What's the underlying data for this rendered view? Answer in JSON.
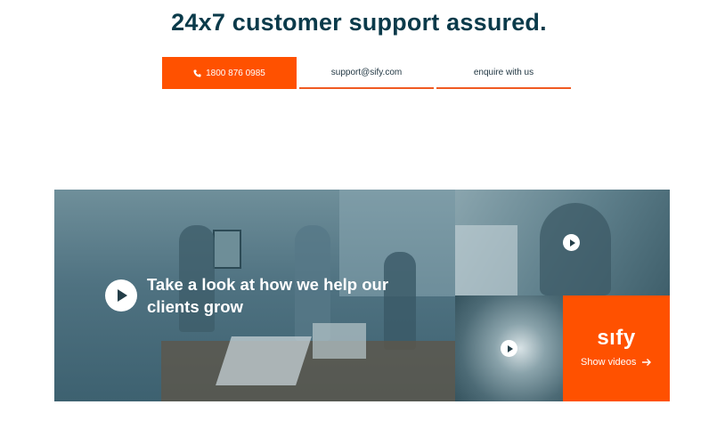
{
  "heading": "24x7 customer support assured.",
  "contacts": {
    "phone": {
      "label": "1800 876 0985",
      "icon": "phone-icon"
    },
    "email": {
      "label": "support@sify.com"
    },
    "enquire": {
      "label": "enquire with us"
    }
  },
  "media": {
    "main_headline": "Take a look at how we help our clients grow",
    "brand": {
      "logo": "sıfy",
      "link_label": "Show videos",
      "icon": "arrow-right-icon"
    }
  },
  "colors": {
    "accent": "#ff5100",
    "heading": "#0a3a4a",
    "overlay": "#4f7281"
  }
}
